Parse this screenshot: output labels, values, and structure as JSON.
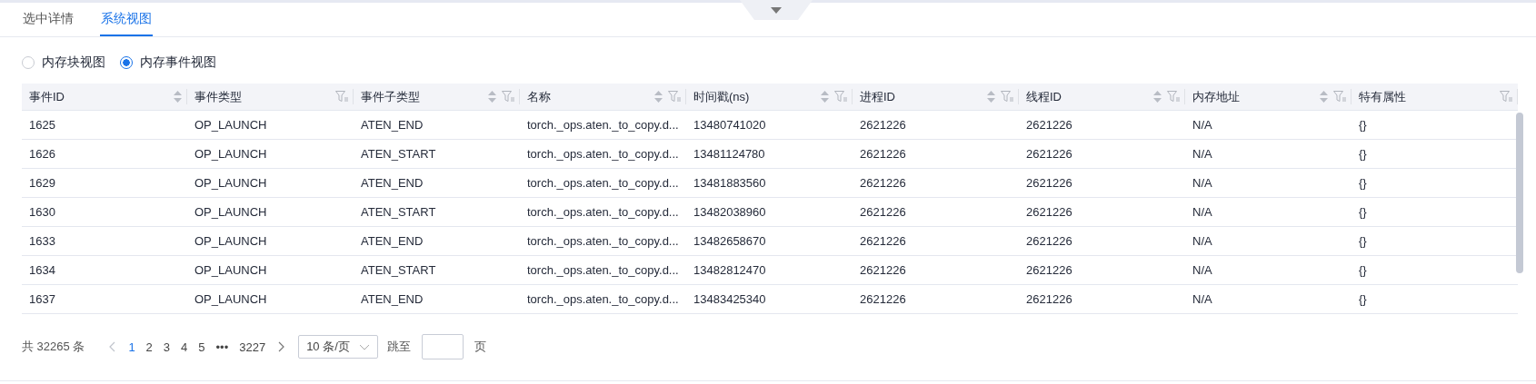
{
  "tabs": [
    {
      "label": "选中详情",
      "selected": false
    },
    {
      "label": "系统视图",
      "selected": true
    }
  ],
  "view_options": [
    {
      "label": "内存块视图",
      "selected": false
    },
    {
      "label": "内存事件视图",
      "selected": true
    }
  ],
  "table": {
    "columns": [
      {
        "label": "事件ID",
        "sortable": true,
        "filterable": false
      },
      {
        "label": "事件类型",
        "sortable": false,
        "filterable": true
      },
      {
        "label": "事件子类型",
        "sortable": true,
        "filterable": true
      },
      {
        "label": "名称",
        "sortable": true,
        "filterable": true
      },
      {
        "label": "时间戳(ns)",
        "sortable": true,
        "filterable": true
      },
      {
        "label": "进程ID",
        "sortable": true,
        "filterable": true
      },
      {
        "label": "线程ID",
        "sortable": true,
        "filterable": true
      },
      {
        "label": "内存地址",
        "sortable": true,
        "filterable": true
      },
      {
        "label": "特有属性",
        "sortable": false,
        "filterable": true
      }
    ],
    "rows": [
      [
        "1625",
        "OP_LAUNCH",
        "ATEN_END",
        "torch._ops.aten._to_copy.d...",
        "13480741020",
        "2621226",
        "2621226",
        "N/A",
        "{}"
      ],
      [
        "1626",
        "OP_LAUNCH",
        "ATEN_START",
        "torch._ops.aten._to_copy.d...",
        "13481124780",
        "2621226",
        "2621226",
        "N/A",
        "{}"
      ],
      [
        "1629",
        "OP_LAUNCH",
        "ATEN_END",
        "torch._ops.aten._to_copy.d...",
        "13481883560",
        "2621226",
        "2621226",
        "N/A",
        "{}"
      ],
      [
        "1630",
        "OP_LAUNCH",
        "ATEN_START",
        "torch._ops.aten._to_copy.d...",
        "13482038960",
        "2621226",
        "2621226",
        "N/A",
        "{}"
      ],
      [
        "1633",
        "OP_LAUNCH",
        "ATEN_END",
        "torch._ops.aten._to_copy.d...",
        "13482658670",
        "2621226",
        "2621226",
        "N/A",
        "{}"
      ],
      [
        "1634",
        "OP_LAUNCH",
        "ATEN_START",
        "torch._ops.aten._to_copy.d...",
        "13482812470",
        "2621226",
        "2621226",
        "N/A",
        "{}"
      ],
      [
        "1637",
        "OP_LAUNCH",
        "ATEN_END",
        "torch._ops.aten._to_copy.d...",
        "13483425340",
        "2621226",
        "2621226",
        "N/A",
        "{}"
      ]
    ]
  },
  "pagination": {
    "total": "共 32265 条",
    "pages": [
      {
        "label": "1",
        "selected": true
      },
      {
        "label": "2",
        "selected": false
      },
      {
        "label": "3",
        "selected": false
      },
      {
        "label": "4",
        "selected": false
      },
      {
        "label": "5",
        "selected": false
      },
      {
        "label": "•••",
        "selected": false
      },
      {
        "label": "3227",
        "selected": false
      }
    ],
    "page_size": "10 条/页",
    "jump_label": "跳至",
    "page_unit": "页"
  }
}
